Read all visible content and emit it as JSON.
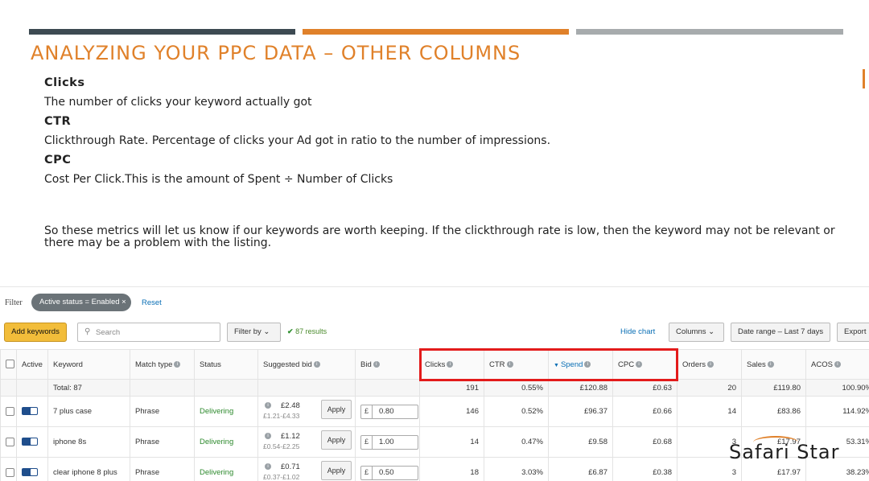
{
  "slide": {
    "title": "ANALYZING YOUR PPC DATA –  OTHER COLUMNS",
    "sections": [
      {
        "heading": "Clicks",
        "text": "The number of clicks your keyword actually got"
      },
      {
        "heading": "CTR",
        "text": "Clickthrough Rate. Percentage of clicks your Ad got in ratio to the number of impressions."
      },
      {
        "heading": "CPC",
        "text": "Cost Per Click.This is the amount of Spent ÷  Number of Clicks"
      }
    ],
    "paragraph": "So these metrics will let us know if our keywords are worth keeping. If the clickthrough rate is low, then the keyword may not be relevant or there may be a problem with the listing.",
    "logo": "Safari Star",
    "colors": {
      "accent": "#e0812a",
      "dark_bar": "#3d4a52",
      "grey_bar": "#a7abad",
      "highlight": "#e31b1b"
    }
  },
  "amazon": {
    "filter_label": "Filter",
    "chip": "Active status = Enabled ×",
    "reset": "Reset",
    "add_keywords": "Add keywords",
    "search_placeholder": "Search",
    "search_icon": "search-icon",
    "filter_by": "Filter by  ⌄",
    "results": "87 results",
    "hide_chart": "Hide chart",
    "columns_btn": "Columns  ⌄",
    "date_range": "Date range – Last 7 days",
    "export": "Export",
    "headers": {
      "active": "Active",
      "keyword": "Keyword",
      "match_type": "Match type",
      "status": "Status",
      "suggested_bid": "Suggested bid",
      "bid": "Bid",
      "clicks": "Clicks",
      "ctr": "CTR",
      "spend": "Spend",
      "cpc": "CPC",
      "orders": "Orders",
      "sales": "Sales",
      "acos": "ACOS"
    },
    "total": {
      "label": "Total: 87",
      "clicks": "191",
      "ctr": "0.55%",
      "spend": "£120.88",
      "cpc": "£0.63",
      "orders": "20",
      "sales": "£119.80",
      "acos": "100.90%"
    },
    "rows": [
      {
        "keyword": "7 plus case",
        "match": "Phrase",
        "status": "Delivering",
        "sugg": "£2.48",
        "range": "£1.21-£4.33",
        "apply": "Apply",
        "currency": "£",
        "bid": "0.80",
        "clicks": "146",
        "ctr": "0.52%",
        "spend": "£96.37",
        "cpc": "£0.66",
        "orders": "14",
        "sales": "£83.86",
        "acos": "114.92%"
      },
      {
        "keyword": "iphone 8s",
        "match": "Phrase",
        "status": "Delivering",
        "sugg": "£1.12",
        "range": "£0.54-£2.25",
        "apply": "Apply",
        "currency": "£",
        "bid": "1.00",
        "clicks": "14",
        "ctr": "0.47%",
        "spend": "£9.58",
        "cpc": "£0.68",
        "orders": "3",
        "sales": "£17.97",
        "acos": "53.31%"
      },
      {
        "keyword": "clear iphone 8 plus",
        "match": "Phrase",
        "status": "Delivering",
        "sugg": "£0.71",
        "range": "£0.37-£1.02",
        "apply": "Apply",
        "currency": "£",
        "bid": "0.50",
        "clicks": "18",
        "ctr": "3.03%",
        "spend": "£6.87",
        "cpc": "£0.38",
        "orders": "3",
        "sales": "£17.97",
        "acos": "38.23%"
      }
    ]
  }
}
